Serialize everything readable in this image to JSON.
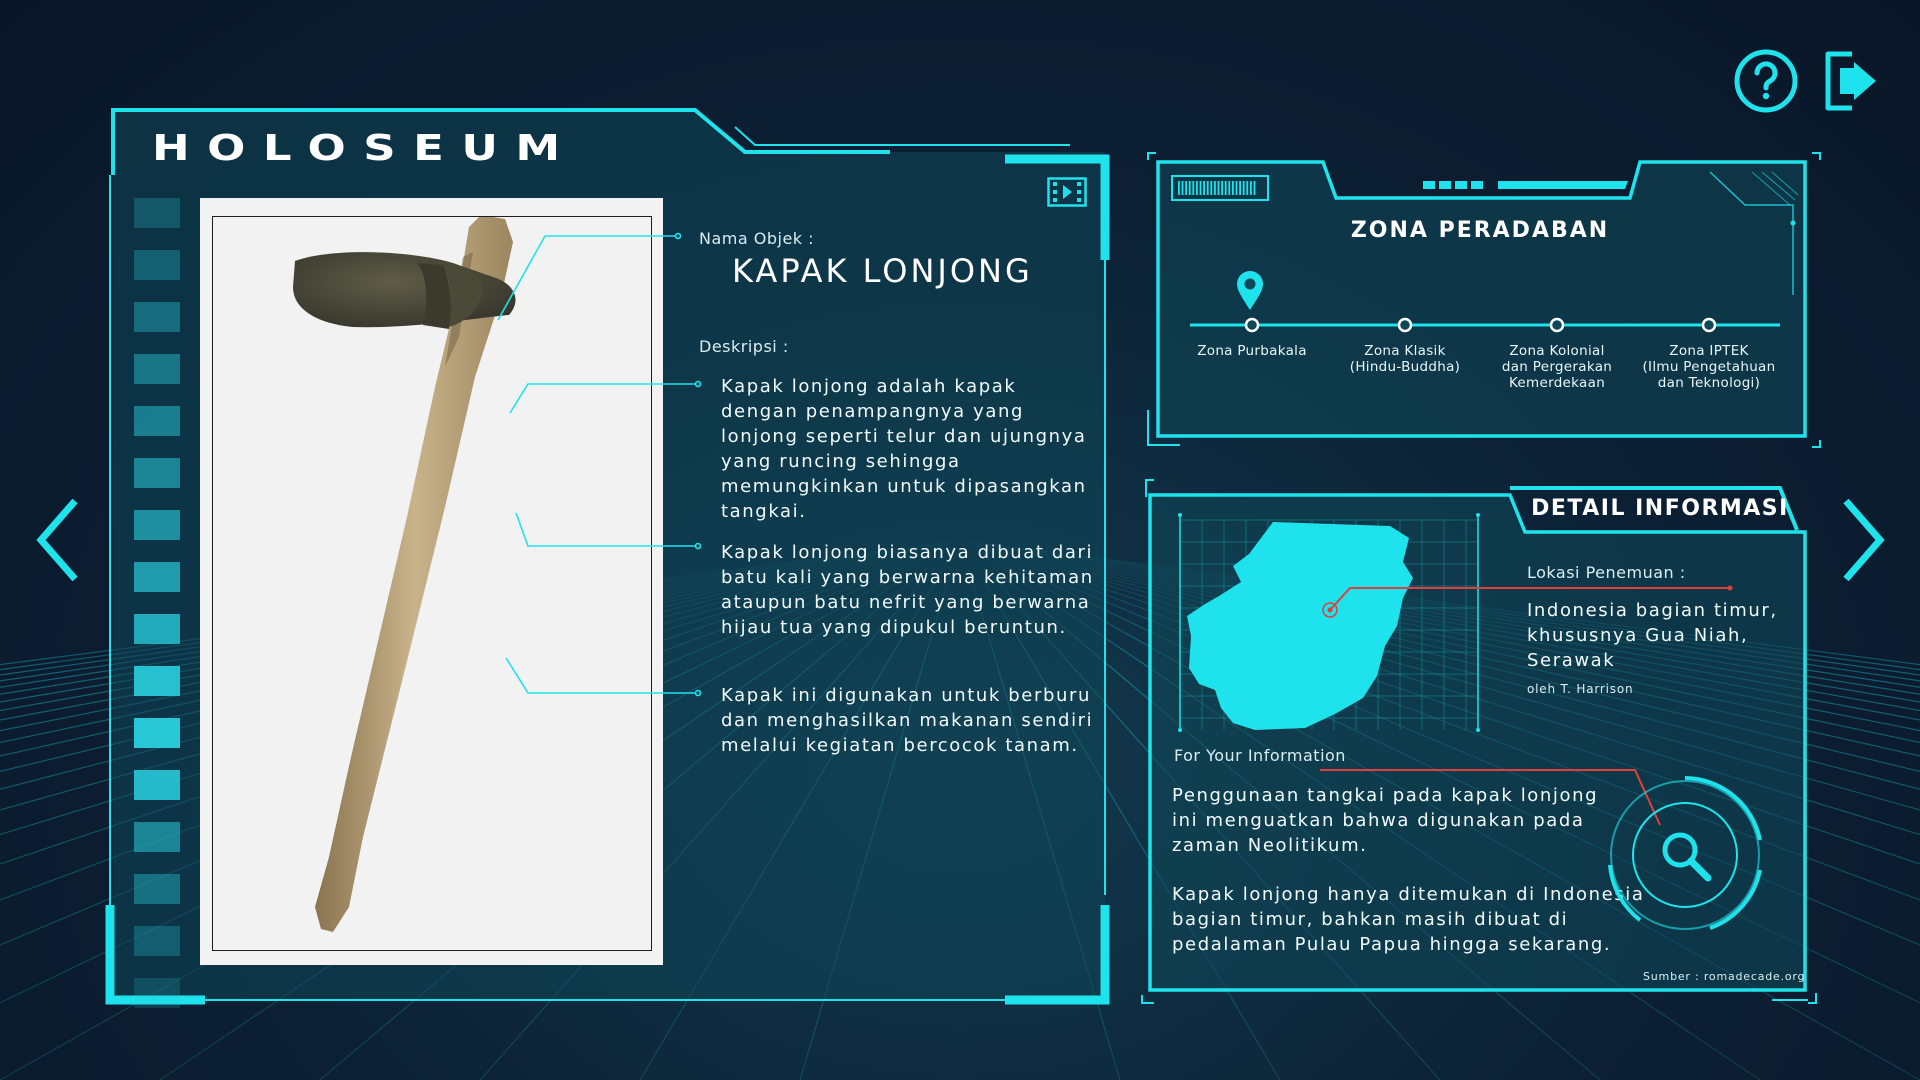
{
  "app": {
    "title": "HOLOSEUM"
  },
  "colors": {
    "accent": "#1ee3ec",
    "panel": "#0f4a5a",
    "red_line": "#e0403c",
    "bg": "#0c1f33"
  },
  "icons": {
    "help": "question-circle-icon",
    "exit": "exit-door-icon",
    "prev": "chevron-left-icon",
    "next": "chevron-right-icon",
    "film": "film-strip-icon",
    "pin": "map-pin-icon",
    "search": "magnifier-icon"
  },
  "object": {
    "name_label": "Nama Objek :",
    "name": "KAPAK LONJONG",
    "desc_label": "Deskripsi :",
    "descriptions": [
      "Kapak lonjong adalah kapak dengan penampangnya yang lonjong seperti telur dan ujungnya yang runcing sehingga memungkinkan untuk dipasangkan tangkai.",
      "Kapak lonjong biasanya dibuat dari batu kali yang berwarna kehitaman ataupun batu nefrit yang berwarna hijau tua yang dipukul beruntun.",
      "Kapak ini digunakan untuk berburu dan menghasilkan makanan sendiri melalui kegiatan bercocok tanam."
    ]
  },
  "zona": {
    "title": "ZONA PERADABAN",
    "items": [
      {
        "label_lines": [
          "Zona Purbakala"
        ]
      },
      {
        "label_lines": [
          "Zona Klasik",
          "(Hindu-Buddha)"
        ]
      },
      {
        "label_lines": [
          "Zona Kolonial",
          "dan Pergerakan",
          "Kemerdekaan"
        ]
      },
      {
        "label_lines": [
          "Zona IPTEK",
          "(Ilmu Pengetahuan",
          "dan Teknologi)"
        ]
      }
    ]
  },
  "detail": {
    "title": "DETAIL INFORMASI",
    "location_label": "Lokasi Penemuan :",
    "location": "Indonesia bagian timur, khususnya Gua Niah, Serawak",
    "discoverer": "oleh T. Harrison",
    "fyi_label": "For Your Information",
    "fyi": [
      "Penggunaan tangkai pada kapak lonjong ini menguatkan bahwa digunakan pada zaman Neolitikum.",
      "Kapak lonjong hanya ditemukan di Indonesia bagian timur, bahkan masih dibuat di pedalaman Pulau Papua hingga sekarang."
    ],
    "source": "Sumber : romadecade.org"
  }
}
